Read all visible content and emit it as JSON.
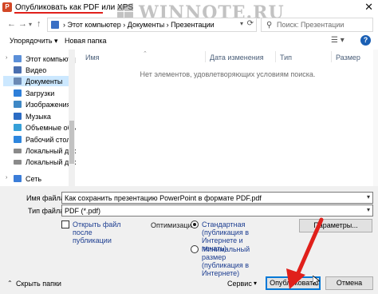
{
  "window": {
    "title": "Опубликовать как PDF или XPS",
    "app_icon_letter": "P",
    "close_glyph": "✕"
  },
  "watermark": {
    "text": "WINNOTE.RU"
  },
  "address": {
    "path": "›  Этот компьютер  ›  Документы  ›  Презентации",
    "search_placeholder": "Поиск: Презентации"
  },
  "toolbar": {
    "organize_label": "Упорядочить ▾",
    "new_folder_label": "Новая папка",
    "help_glyph": "?"
  },
  "sidebar": {
    "items": [
      {
        "label": "Этот компьютер",
        "icon": "computer-icon",
        "color": "#5b8fd8"
      },
      {
        "label": "Видео",
        "icon": "video-icon",
        "color": "#4a6fb0"
      },
      {
        "label": "Документы",
        "icon": "documents-icon",
        "color": "#6b8ab5"
      },
      {
        "label": "Загрузки",
        "icon": "downloads-icon",
        "color": "#2e7fd9"
      },
      {
        "label": "Изображения",
        "icon": "pictures-icon",
        "color": "#3f88c5"
      },
      {
        "label": "Музыка",
        "icon": "music-icon",
        "color": "#2b6cc4"
      },
      {
        "label": "Объемные объе",
        "icon": "3d-objects-icon",
        "color": "#36a0d8"
      },
      {
        "label": "Рабочий стол",
        "icon": "desktop-icon",
        "color": "#2e86de"
      },
      {
        "label": "Локальный дис",
        "icon": "drive-icon",
        "color": "#8a8a8a"
      },
      {
        "label": "Локальный дис",
        "icon": "drive-icon",
        "color": "#8a8a8a"
      },
      {
        "label": "Сеть",
        "icon": "network-icon",
        "color": "#3b7dd8"
      }
    ],
    "selected_index": 2
  },
  "filelist": {
    "columns": [
      "Имя",
      "Дата изменения",
      "Тип",
      "Размер"
    ],
    "empty_message": "Нет элементов, удовлетворяющих условиям поиска."
  },
  "form": {
    "filename_label": "Имя файла:",
    "filename_value": "Как сохранить презентацию PowerPoint в формате PDF.pdf",
    "filetype_label": "Тип файла:",
    "filetype_value": "PDF (*.pdf)",
    "open_after_label": "Открыть файл после публикации",
    "open_after_checked": false,
    "optimize_label": "Оптимизация:",
    "opt_standard_label": "Стандартная (публикация в Интернете и печать)",
    "opt_minimal_label": "Минимальный размер (публикация в Интернете)",
    "opt_selected": "standard",
    "options_button": "Параметры..."
  },
  "footer": {
    "hide_folders_label": "Скрыть папки",
    "service_label": "Сервис",
    "publish_button": "Опубликовать",
    "cancel_button": "Отмена"
  },
  "colors": {
    "accent": "#0078d7",
    "annotation_red": "#e0201b"
  }
}
